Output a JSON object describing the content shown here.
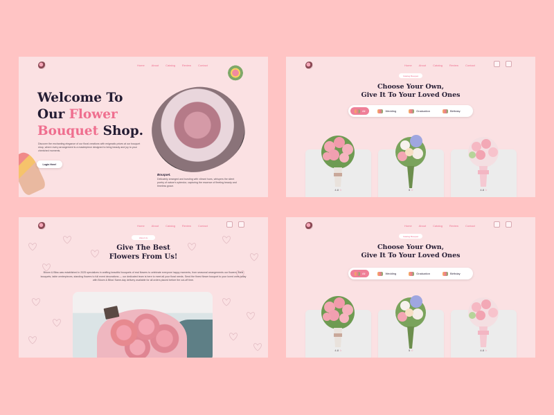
{
  "nav": {
    "items": [
      "Home",
      "About",
      "Catalog",
      "Review",
      "Contact"
    ]
  },
  "hero": {
    "title_line1": "Welcome To",
    "title_our": "Our",
    "title_flower": "Flower",
    "title_bouquet": "Bouquet",
    "title_shop": "Shop.",
    "description": "Discover the enchanting elegance of our floral creations with enigmatic prices at our bouquet shop, where every arrangement is a masterpiece designed to bring beauty and joy to your cherished moments.",
    "button_label": "Login Here!",
    "caption_title": "Bouquet.",
    "caption": "Delicately arranged and bursting with vibrant hues, whispers the silent poetry of nature's splendor, capturing the essence of fleeting beauty and timeless grace."
  },
  "catalog": {
    "tag": "Catalog Bouquet",
    "title_line1": "Choose Your Own,",
    "title_line2": "Give It To Your Loved Ones",
    "filters": [
      {
        "label": "All",
        "active": true
      },
      {
        "label": "Wedding",
        "active": false
      },
      {
        "label": "Graduation",
        "active": false
      },
      {
        "label": "Birthday",
        "active": false
      }
    ],
    "ratings": [
      "4.8",
      "5",
      "4.8"
    ]
  },
  "about": {
    "tag": "About Us",
    "title_line1": "Give The Best",
    "title_line2": "Flowers From Us!",
    "description": "Bloom & Bliss was established in 2025 specializes in crafting beautiful bouquets of real flowers to celebrate everyone happy moments, from seasonal arrangements our flowers, floral bouquets, table centerpieces, standing flowers to full event decorations — our dedicated team is here to meet all your floral needs. Send the finest flower bouquet to your loved ones today with Bloom & Bliss! Same-day delivery available for all orders placed before the cut-off time."
  },
  "colors": {
    "background": "#ffc4c4",
    "panel": "#fbe1e3",
    "accent": "#ef6f8f",
    "heading": "#241c33"
  }
}
